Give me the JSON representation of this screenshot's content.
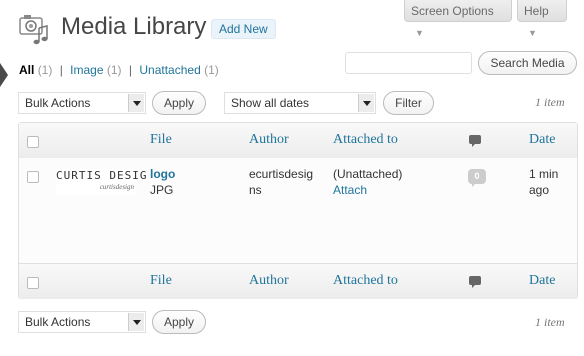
{
  "header": {
    "title": "Media Library",
    "add_new_label": "Add New"
  },
  "top_tabs": {
    "screen_options": "Screen Options",
    "help": "Help"
  },
  "filters": {
    "all": {
      "label": "All",
      "count": "(1)"
    },
    "image": {
      "label": "Image",
      "count": "(1)"
    },
    "unattached": {
      "label": "Unattached",
      "count": "(1)"
    },
    "separator": "|"
  },
  "search": {
    "value": "",
    "button_label": "Search Media"
  },
  "top_nav": {
    "bulk_actions": "Bulk Actions",
    "apply_label": "Apply",
    "dates": "Show all dates",
    "filter_label": "Filter",
    "count": "1 item"
  },
  "bottom_nav": {
    "bulk_actions": "Bulk Actions",
    "apply_label": "Apply",
    "count": "1 item"
  },
  "table": {
    "columns": {
      "file": "File",
      "author": "Author",
      "attached_to": "Attached to",
      "date": "Date"
    },
    "rows": [
      {
        "thumb_text": "CURTIS DESIG",
        "thumb_tagline": "curtisdesign",
        "title": "logo",
        "type": "JPG",
        "author_line1": "ecurtisdesig",
        "author_line2": "ns",
        "attached": "(Unattached)",
        "attach_link": "Attach",
        "comments": "0",
        "date_line1": "1 min",
        "date_line2": "ago"
      }
    ]
  },
  "colors": {
    "link": "#21759b",
    "title": "#464646",
    "border": "#dfdfdf"
  }
}
